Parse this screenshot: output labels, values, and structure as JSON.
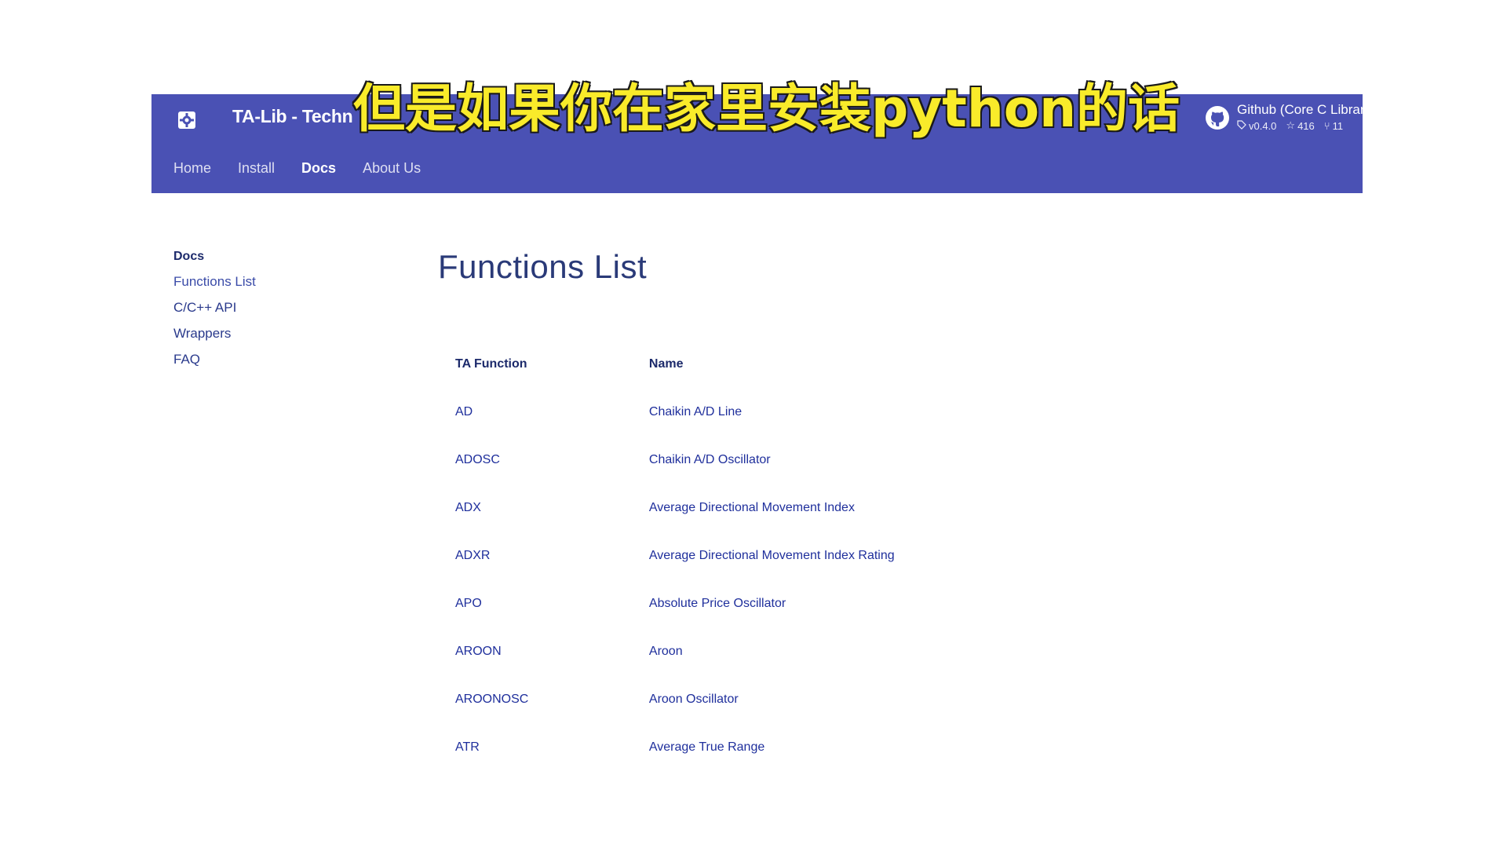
{
  "header": {
    "site_title": "TA-Lib - Techn",
    "repo": {
      "name": "Github (Core C Library",
      "version": "v0.4.0",
      "stars": "416",
      "forks": "11"
    },
    "tabs": [
      {
        "label": "Home",
        "active": false
      },
      {
        "label": "Install",
        "active": false
      },
      {
        "label": "Docs",
        "active": true
      },
      {
        "label": "About Us",
        "active": false
      }
    ],
    "bg_color": "#4a51b4"
  },
  "sidebar": {
    "heading": "Docs",
    "items": [
      {
        "label": "Functions List",
        "active": true
      },
      {
        "label": "C/C++ API",
        "active": false
      },
      {
        "label": "Wrappers",
        "active": false
      },
      {
        "label": "FAQ",
        "active": false
      }
    ]
  },
  "main": {
    "title": "Functions List",
    "table": {
      "headers": [
        "TA Function",
        "Name"
      ],
      "rows": [
        [
          "AD",
          "Chaikin A/D Line"
        ],
        [
          "ADOSC",
          "Chaikin A/D Oscillator"
        ],
        [
          "ADX",
          "Average Directional Movement Index"
        ],
        [
          "ADXR",
          "Average Directional Movement Index Rating"
        ],
        [
          "APO",
          "Absolute Price Oscillator"
        ],
        [
          "AROON",
          "Aroon"
        ],
        [
          "AROONOSC",
          "Aroon Oscillator"
        ],
        [
          "ATR",
          "Average True Range"
        ]
      ]
    }
  },
  "overlay": {
    "subtitle": "但是如果你在家里安装python的话",
    "color": "#f9eb2a"
  },
  "icons": {
    "logo": "gear-icon",
    "repo": "github-icon",
    "tag": "tag-icon",
    "star": "star-icon",
    "fork": "fork-icon"
  }
}
